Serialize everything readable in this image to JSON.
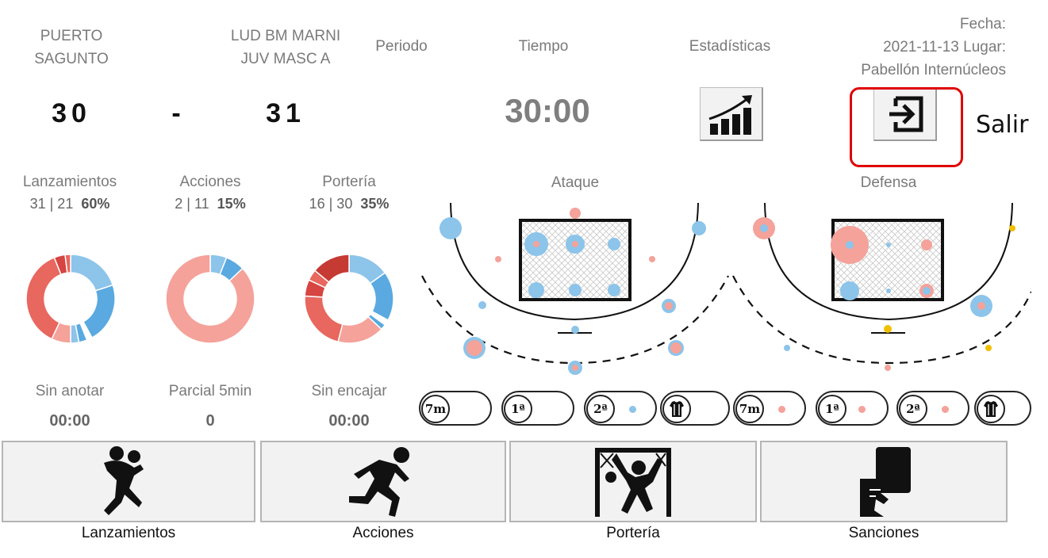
{
  "header": {
    "home_team_line1": "PUERTO",
    "home_team_line2": "SAGUNTO",
    "away_team_line1": "LUD BM MARNI",
    "away_team_line2": "JUV MASC A",
    "period_label": "Periodo",
    "time_label": "Tiempo",
    "stats_label": "Estadísticas",
    "date_line1": "Fecha:",
    "date_line2": "2021-11-13  Lugar:",
    "date_line3": "Pabellón Internúcleos",
    "home_score": "30",
    "score_sep": "-",
    "away_score": "31",
    "time_value": "30:00",
    "stats_icon": "bar-chart-trend-icon",
    "exit_icon": "exit-icon",
    "exit_annotation": "Salir",
    "annotation_color": "#e00000"
  },
  "stats": [
    {
      "title": "Lanzamientos",
      "nums": "31 | 21",
      "pct": "60%"
    },
    {
      "title": "Acciones",
      "nums": "2 | 11",
      "pct": "15%"
    },
    {
      "title": "Portería",
      "nums": "16 | 30",
      "pct": "35%"
    }
  ],
  "donuts": [
    {
      "segments": [
        {
          "value": 20,
          "color": "#8cc4ea"
        },
        {
          "value": 22,
          "color": "#5aa9e0"
        },
        {
          "value": 2,
          "color": "#ffffff"
        },
        {
          "value": 3,
          "color": "#5aa9e0"
        },
        {
          "value": 3,
          "color": "#8cc4ea"
        },
        {
          "value": 7,
          "color": "#f4a29a"
        },
        {
          "value": 37,
          "color": "#e8675e"
        },
        {
          "value": 4,
          "color": "#d64541"
        },
        {
          "value": 2,
          "color": "#e8675e"
        }
      ]
    },
    {
      "segments": [
        {
          "value": 6,
          "color": "#8cc4ea"
        },
        {
          "value": 7,
          "color": "#5aa9e0"
        },
        {
          "value": 87,
          "color": "#f4a29a"
        }
      ]
    },
    {
      "segments": [
        {
          "value": 15,
          "color": "#8cc4ea"
        },
        {
          "value": 18,
          "color": "#5aa9e0"
        },
        {
          "value": 2,
          "color": "#ffffff"
        },
        {
          "value": 2,
          "color": "#5aa9e0"
        },
        {
          "value": 17,
          "color": "#f4a29a"
        },
        {
          "value": 22,
          "color": "#e8675e"
        },
        {
          "value": 6,
          "color": "#d64541"
        },
        {
          "value": 4,
          "color": "#e8675e"
        },
        {
          "value": 14,
          "color": "#c53a32"
        }
      ]
    }
  ],
  "courts": {
    "attack_label": "Ataque",
    "defense_label": "Defensa",
    "blue": "#8cc4ea",
    "red": "#f4a29a",
    "yellow": "#f0c000"
  },
  "counters": [
    {
      "title": "Sin anotar",
      "value": "00:00"
    },
    {
      "title": "Parcial 5min",
      "value": "0"
    },
    {
      "title": "Sin encajar",
      "value": "00:00"
    }
  ],
  "pills": [
    {
      "label": "7m",
      "dot": ""
    },
    {
      "label": "1ª",
      "dot": ""
    },
    {
      "label": "2ª",
      "dot": "#8cc4ea"
    },
    {
      "label": "jersey",
      "dot": ""
    },
    {
      "label": "7m",
      "dot": "#f4a29a"
    },
    {
      "label": "1ª",
      "dot": "#f4a29a"
    },
    {
      "label": "2ª",
      "dot": "#f4a29a"
    },
    {
      "label": "jersey",
      "dot": ""
    }
  ],
  "actions": [
    {
      "label": "Lanzamientos",
      "icon": "player-throwing-icon"
    },
    {
      "label": "Acciones",
      "icon": "player-running-icon"
    },
    {
      "label": "Portería",
      "icon": "goalkeeper-icon"
    },
    {
      "label": "Sanciones",
      "icon": "penalty-card-icon"
    }
  ]
}
